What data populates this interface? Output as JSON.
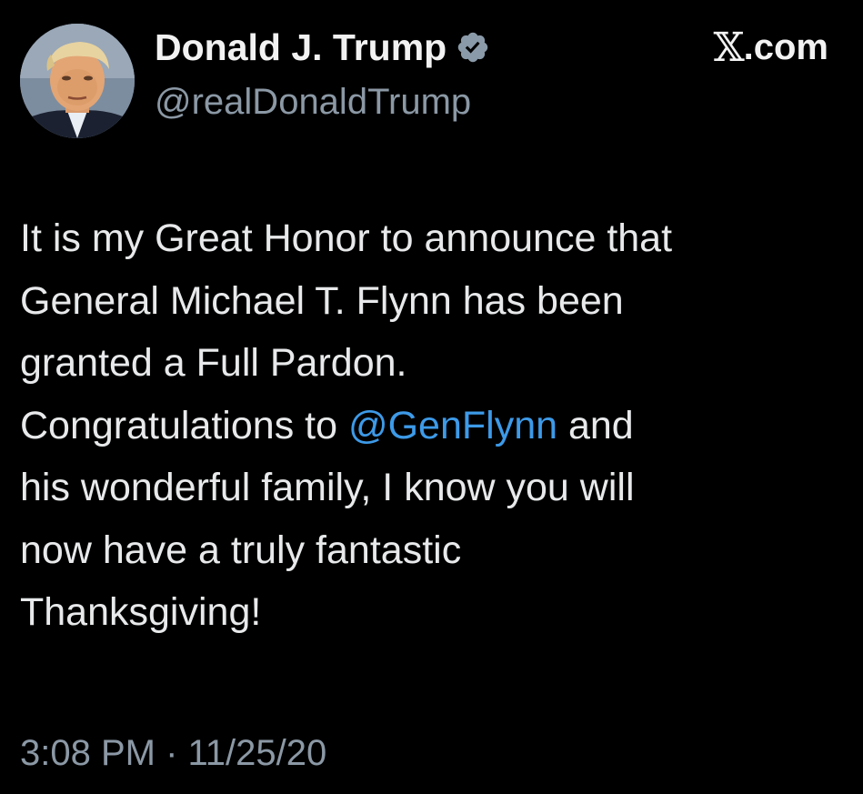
{
  "author": {
    "display_name": "Donald J. Trump",
    "handle": "@realDonaldTrump",
    "verified": true,
    "verified_icon": "verified-badge-icon",
    "avatar_icon": "profile-avatar"
  },
  "source": {
    "x_glyph": "𝕏",
    "domain": ".com"
  },
  "tweet": {
    "lines": [
      "It is my Great Honor to announce that",
      "General Michael T. Flynn has been",
      "granted a Full Pardon.",
      "Congratulations to ",
      "his wonderful family, I know you will",
      "now have a truly fantastic",
      "Thanksgiving!"
    ],
    "mention": "@GenFlynn",
    "after_mention": " and"
  },
  "timestamp": {
    "time": "3:08 PM",
    "separator": " · ",
    "date": "11/25/20"
  },
  "colors": {
    "background": "#000000",
    "text": "#e7e9ea",
    "muted": "#8b98a5",
    "link": "#3d9ae8",
    "badge": "#8a9aa8"
  }
}
